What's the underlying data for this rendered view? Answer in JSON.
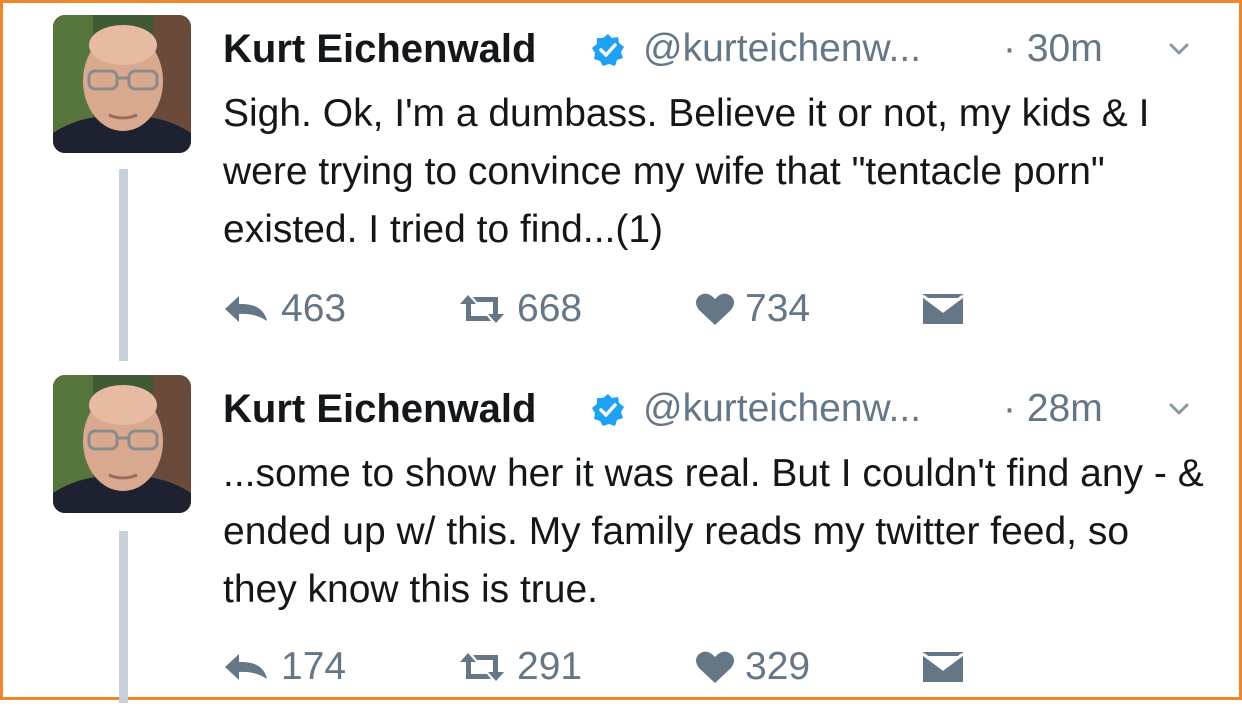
{
  "tweets": [
    {
      "name": "Kurt Eichenwald",
      "handle": "@kurteichenw...",
      "time": "· 30m",
      "text": "Sigh. Ok, I'm a dumbass. Believe it or not, my kids & I were trying to convince my wife that \"tentacle porn\" existed. I tried to find...(1)",
      "replies": "463",
      "retweets": "668",
      "likes": "734"
    },
    {
      "name": "Kurt Eichenwald",
      "handle": "@kurteichenw...",
      "time": "· 28m",
      "text": "...some to show her it was real. But I couldn't find any - & ended up w/ this. My family reads my twitter feed, so they know this is true.",
      "replies": "174",
      "retweets": "291",
      "likes": "329"
    }
  ],
  "icons": {
    "verified": "verified-badge-icon",
    "more": "chevron-down-icon",
    "reply": "reply-icon",
    "retweet": "retweet-icon",
    "like": "heart-icon",
    "message": "envelope-icon"
  },
  "colors": {
    "frame_border": "#f0862a",
    "verified_blue": "#1da1f2",
    "secondary_text": "#657786",
    "primary_text": "#14171a",
    "thread_line": "#c8d1d9"
  }
}
